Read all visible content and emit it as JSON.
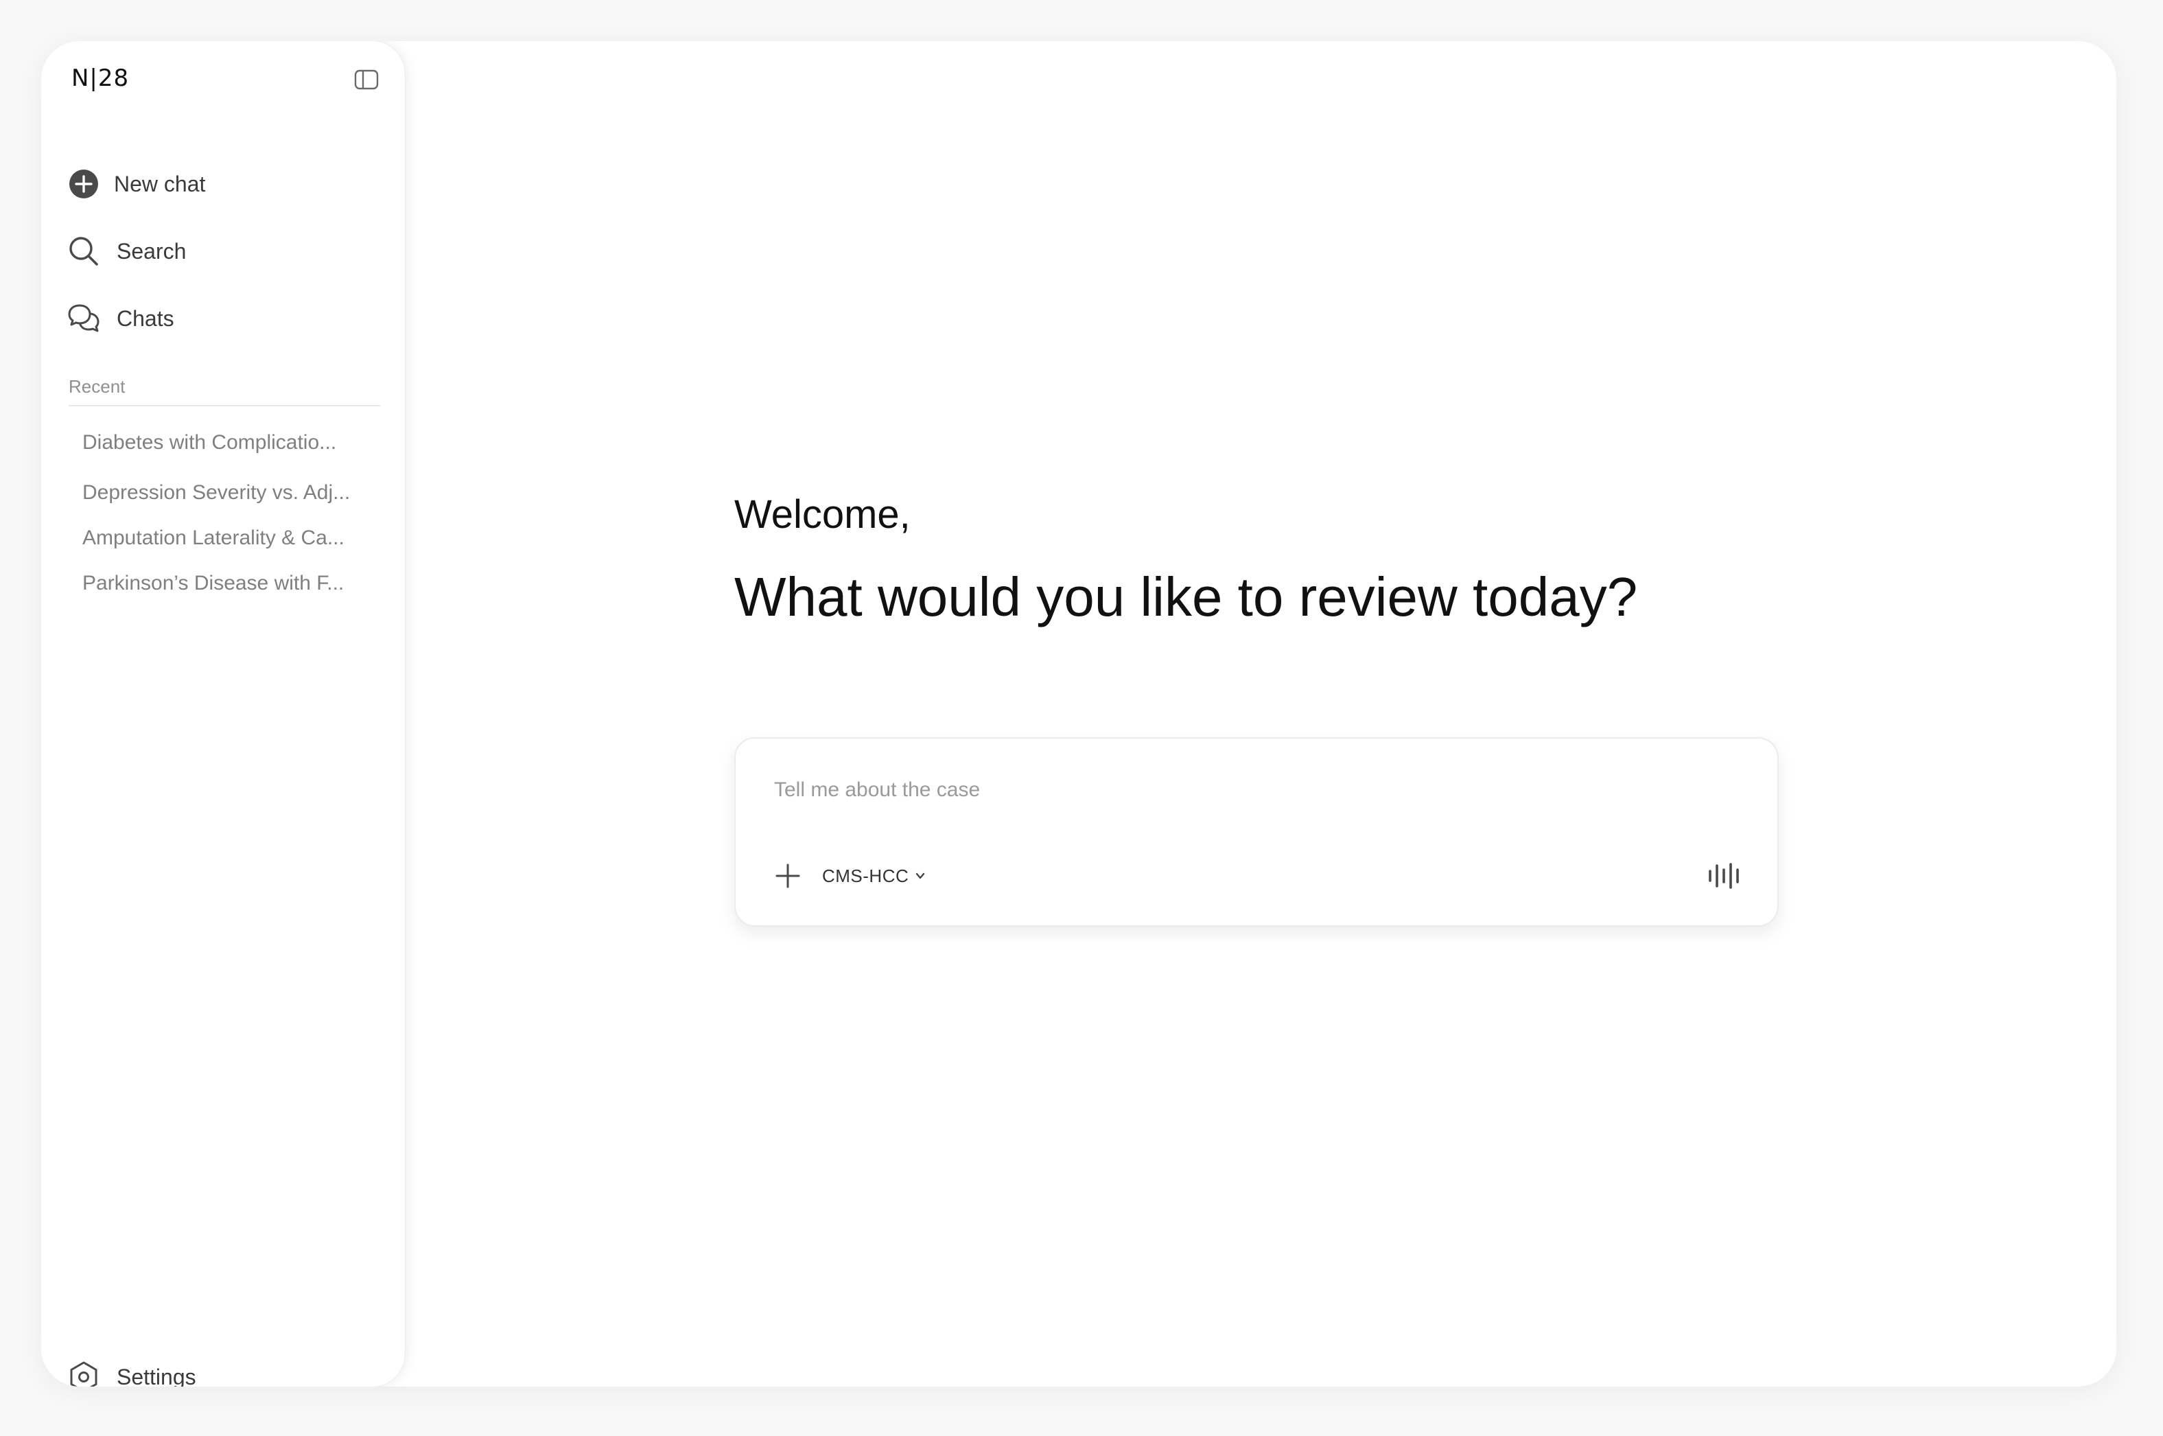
{
  "app": {
    "logo": "N|28"
  },
  "sidebar": {
    "nav": {
      "new_chat": "New chat",
      "search": "Search",
      "chats": "Chats"
    },
    "recent_title": "Recent",
    "recent_items": [
      "Diabetes with Complicatio...",
      "Depression Severity vs. Adj...",
      "Amputation Laterality & Ca...",
      "Parkinson’s Disease with F..."
    ],
    "settings": "Settings"
  },
  "main": {
    "welcome": "Welcome,",
    "question": "What would you like to review today?",
    "composer": {
      "placeholder": "Tell me about the case",
      "value": "",
      "model": "CMS-HCC"
    }
  },
  "icons": {
    "collapse": "sidebar-toggle-icon",
    "new_chat": "plus-circle-icon",
    "search": "search-icon",
    "chats": "chat-bubbles-icon",
    "settings": "settings-hexagon-icon",
    "attach": "plus-icon",
    "chevron": "chevron-down-icon",
    "voice": "audio-waveform-icon"
  },
  "colors": {
    "background": "#f8f8f8",
    "surface": "#ffffff",
    "text": "#111111",
    "muted": "#7f7f7f",
    "icon": "#4a4a4a"
  }
}
